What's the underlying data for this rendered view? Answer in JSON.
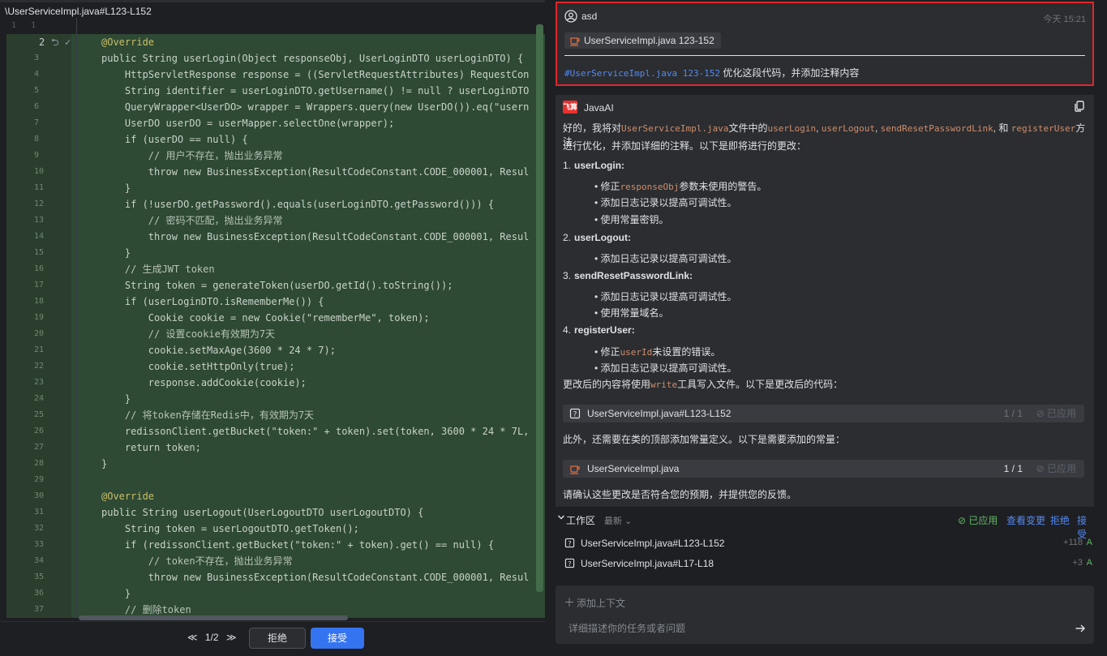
{
  "editor": {
    "file_path": "\\UserServiceImpl.java#L123-L152",
    "lines": [
      {
        "num": "1   1",
        "code": "",
        "type": "plain"
      },
      {
        "num": "2",
        "mark": "⮌ ✓",
        "code": "@Override",
        "type": "added",
        "current": true
      },
      {
        "num": "3",
        "code": "public String userLogin(Object responseObj, UserLoginDTO userLoginDTO) {",
        "type": "added"
      },
      {
        "num": "4",
        "code": "    HttpServletResponse response = ((ServletRequestAttributes) RequestCon",
        "type": "added"
      },
      {
        "num": "5",
        "code": "    String identifier = userLoginDTO.getUsername() != null ? userLoginDTO",
        "type": "added"
      },
      {
        "num": "6",
        "code": "    QueryWrapper<UserDO> wrapper = Wrappers.query(new UserDO()).eq(\"usern",
        "type": "added"
      },
      {
        "num": "7",
        "code": "    UserDO userDO = userMapper.selectOne(wrapper);",
        "type": "added"
      },
      {
        "num": "8",
        "code": "    if (userDO == null) {",
        "type": "added"
      },
      {
        "num": "9",
        "code": "        // 用户不存在，抛出业务异常",
        "type": "added"
      },
      {
        "num": "10",
        "code": "        throw new BusinessException(ResultCodeConstant.CODE_000001, Resul",
        "type": "added"
      },
      {
        "num": "11",
        "code": "    }",
        "type": "added"
      },
      {
        "num": "12",
        "code": "    if (!userDO.getPassword().equals(userLoginDTO.getPassword())) {",
        "type": "added"
      },
      {
        "num": "13",
        "code": "        // 密码不匹配，抛出业务异常",
        "type": "added"
      },
      {
        "num": "14",
        "code": "        throw new BusinessException(ResultCodeConstant.CODE_000001, Resul",
        "type": "added"
      },
      {
        "num": "15",
        "code": "    }",
        "type": "added"
      },
      {
        "num": "16",
        "code": "    // 生成JWT token",
        "type": "added"
      },
      {
        "num": "17",
        "code": "    String token = generateToken(userDO.getId().toString());",
        "type": "added"
      },
      {
        "num": "18",
        "code": "    if (userLoginDTO.isRememberMe()) {",
        "type": "added"
      },
      {
        "num": "19",
        "code": "        Cookie cookie = new Cookie(\"rememberMe\", token);",
        "type": "added"
      },
      {
        "num": "20",
        "code": "        // 设置cookie有效期为7天",
        "type": "added"
      },
      {
        "num": "21",
        "code": "        cookie.setMaxAge(3600 * 24 * 7);",
        "type": "added"
      },
      {
        "num": "22",
        "code": "        cookie.setHttpOnly(true);",
        "type": "added"
      },
      {
        "num": "23",
        "code": "        response.addCookie(cookie);",
        "type": "added"
      },
      {
        "num": "24",
        "code": "    }",
        "type": "added"
      },
      {
        "num": "25",
        "code": "    // 将token存储在Redis中，有效期为7天",
        "type": "added"
      },
      {
        "num": "26",
        "code": "    redissonClient.getBucket(\"token:\" + token).set(token, 3600 * 24 * 7L,",
        "type": "added"
      },
      {
        "num": "27",
        "code": "    return token;",
        "type": "added"
      },
      {
        "num": "28",
        "code": "}",
        "type": "added"
      },
      {
        "num": "29",
        "code": "",
        "type": "added"
      },
      {
        "num": "30",
        "code": "@Override",
        "type": "added"
      },
      {
        "num": "31",
        "code": "public String userLogout(UserLogoutDTO userLogoutDTO) {",
        "type": "added"
      },
      {
        "num": "32",
        "code": "    String token = userLogoutDTO.getToken();",
        "type": "added"
      },
      {
        "num": "33",
        "code": "    if (redissonClient.getBucket(\"token:\" + token).get() == null) {",
        "type": "added"
      },
      {
        "num": "34",
        "code": "        // token不存在，抛出业务异常",
        "type": "added"
      },
      {
        "num": "35",
        "code": "        throw new BusinessException(ResultCodeConstant.CODE_000001, Resul",
        "type": "added"
      },
      {
        "num": "36",
        "code": "    }",
        "type": "added"
      },
      {
        "num": "37",
        "code": "    // 删除token",
        "type": "added"
      }
    ],
    "pager": {
      "prev": "≪",
      "text": "1/2",
      "next": "≫"
    },
    "reject_label": "拒绝",
    "accept_label": "接受"
  },
  "chat": {
    "user": {
      "name": "asd",
      "time": "今天 15:21",
      "file_chip": "UserServiceImpl.java 123-152",
      "prompt_ref": "#UserServiceImpl.java 123-152",
      "prompt_text": " 优化这段代码，并添加注释内容"
    },
    "ai": {
      "logo_text": "飞算",
      "name": "JavaAI",
      "intro_1": "好的，我将对",
      "intro_file": "UserServiceImpl.java",
      "intro_2": "文件中的",
      "intro_m1": "userLogin",
      "intro_sep1": ", ",
      "intro_m2": "userLogout",
      "intro_sep2": ", ",
      "intro_m3": "sendResetPasswordLink",
      "intro_sep3": ", 和 ",
      "intro_m4": "registerUser",
      "intro_3": "方法",
      "intro_line2": "进行优化，并添加详细的注释。以下是即将进行的更改：",
      "items": [
        {
          "num": "1.",
          "title": "userLogin",
          "colon": ":"
        },
        {
          "num": "2.",
          "title": "userLogout",
          "colon": ":"
        },
        {
          "num": "3.",
          "title": "sendResetPasswordLink",
          "colon": ":"
        },
        {
          "num": "4.",
          "title": "registerUser",
          "colon": ":"
        }
      ],
      "b1_1_pre": "修正",
      "b1_1_code": "responseObj",
      "b1_1_post": "参数未使用的警告。",
      "b1_2": "添加日志记录以提高可调试性。",
      "b1_3": "使用常量密钥。",
      "b2_1": "添加日志记录以提高可调试性。",
      "b3_1": "添加日志记录以提高可调试性。",
      "b3_2": "使用常量域名。",
      "b4_1_pre": "修正",
      "b4_1_code": "userId",
      "b4_1_post": "未设置的错误。",
      "b4_2": "添加日志记录以提高可调试性。",
      "write_pre": "更改后的内容将使用",
      "write_code": "write",
      "write_post": "工具写入文件。以下是更改后的代码：",
      "chip1": {
        "name": "UserServiceImpl.java#L123-L152",
        "count": "1 / 1",
        "status": "已应用"
      },
      "also": "此外，还需要在类的顶部添加常量定义。以下是需要添加的常量：",
      "chip2": {
        "name": "UserServiceImpl.java",
        "count": "1 / 1",
        "status": "已应用"
      },
      "confirm": "请确认这些更改是否符合您的预期，并提供您的反馈。"
    },
    "workspace": {
      "title": "工作区",
      "latest": "最新",
      "applied": "已应用",
      "view_changes": "查看变更",
      "reject": "拒绝",
      "accept": "接受",
      "files": [
        {
          "name": "UserServiceImpl.java#L123-L152",
          "diff": "+118",
          "status": "A"
        },
        {
          "name": "UserServiceImpl.java#L17-L18",
          "diff": "+3",
          "status": "A"
        }
      ]
    },
    "input": {
      "add_context": "添加上下文",
      "placeholder": "详细描述你的任务或者问题"
    }
  },
  "colors": {
    "accent": "#3574f0",
    "added_bg": "#2e4934",
    "highlight_border": "#e0262b",
    "success": "#5fb865",
    "link": "#548af7"
  }
}
